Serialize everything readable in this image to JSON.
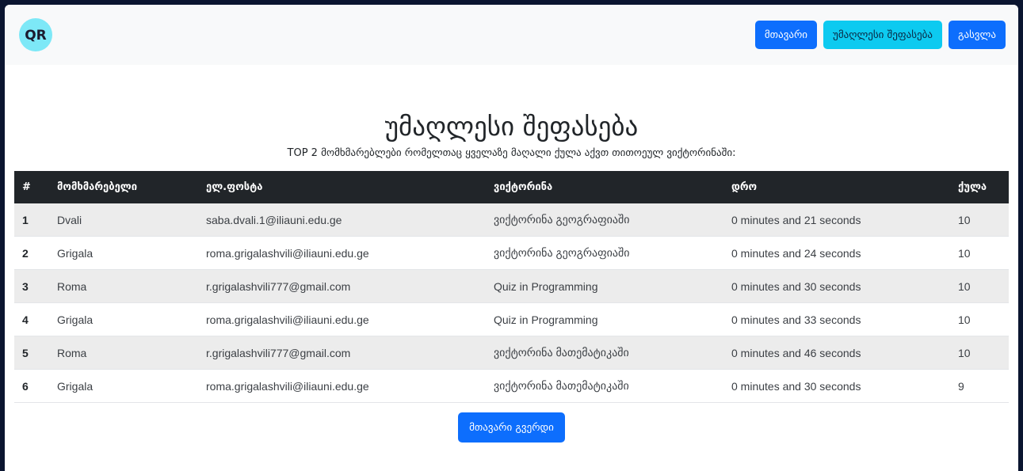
{
  "navbar": {
    "logo_text": "QR",
    "buttons": {
      "home": "მთავარი",
      "top_score": "უმაღლესი შეფასება",
      "logout": "გასვლა"
    }
  },
  "main": {
    "title": "უმაღლესი შეფასება",
    "subtitle": "TOP 2 მომხმარებლები რომელთაც ყველაზე მაღალი ქულა აქვთ თითოეულ ვიქტორინაში:",
    "table": {
      "headers": [
        "#",
        "მომხმარებელი",
        "ელ.ფოსტა",
        "ვიქტორინა",
        "დრო",
        "ქულა"
      ],
      "rows": [
        [
          "1",
          "Dvali",
          "saba.dvali.1@iliauni.edu.ge",
          "ვიქტორინა გეოგრაფიაში",
          "0 minutes and 21 seconds",
          "10"
        ],
        [
          "2",
          "Grigala",
          "roma.grigalashvili@iliauni.edu.ge",
          "ვიქტორინა გეოგრაფიაში",
          "0 minutes and 24 seconds",
          "10"
        ],
        [
          "3",
          "Roma",
          "r.grigalashvili777@gmail.com",
          "Quiz in Programming",
          "0 minutes and 30 seconds",
          "10"
        ],
        [
          "4",
          "Grigala",
          "roma.grigalashvili@iliauni.edu.ge",
          "Quiz in Programming",
          "0 minutes and 33 seconds",
          "10"
        ],
        [
          "5",
          "Roma",
          "r.grigalashvili777@gmail.com",
          "ვიქტორინა მათემატიკაში",
          "0 minutes and 46 seconds",
          "10"
        ],
        [
          "6",
          "Grigala",
          "roma.grigalashvili@iliauni.edu.ge",
          "ვიქტორინა მათემატიკაში",
          "0 minutes and 30 seconds",
          "9"
        ]
      ]
    },
    "home_page_button": "მთავარი გვერდი"
  },
  "colors": {
    "primary": "#0d6efd",
    "info": "#0dcaf0",
    "table_header": "#212529",
    "logo_bg": "#7de8f7"
  }
}
